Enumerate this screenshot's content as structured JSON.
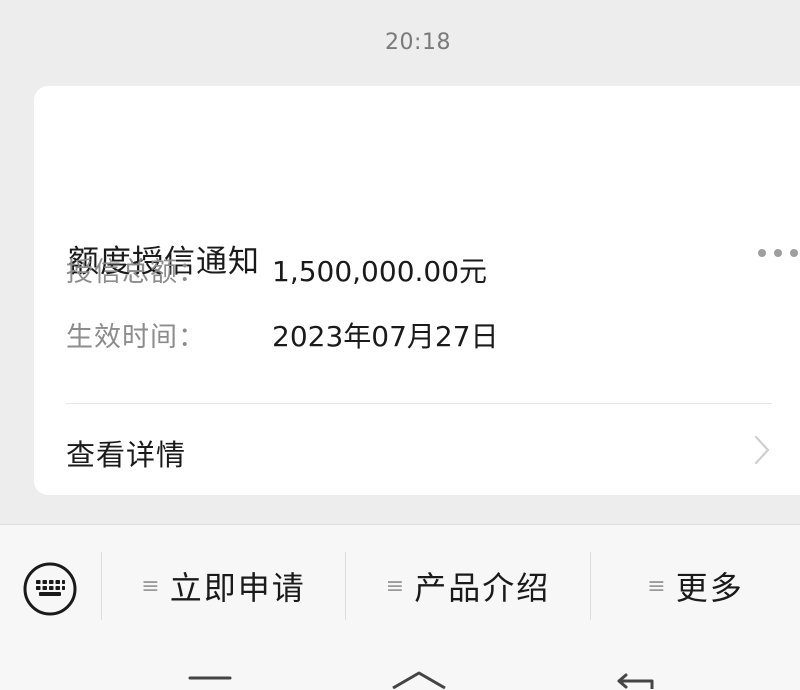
{
  "chat": {
    "timestamp": "20:18"
  },
  "card": {
    "title": "额度授信通知",
    "fields": [
      {
        "label": "授信总额：",
        "value": "1,500,000.00元"
      },
      {
        "label": "生效时间：",
        "value": "2023年07月27日"
      }
    ],
    "detail_label": "查看详情"
  },
  "menu": {
    "items": [
      {
        "label": "立即申请",
        "icon": "menu-lines-icon"
      },
      {
        "label": "产品介绍",
        "icon": "menu-lines-icon"
      },
      {
        "label": "更多",
        "icon": "menu-lines-icon"
      }
    ],
    "keyboard_icon": "keyboard-icon"
  },
  "system_nav": {
    "icons": [
      "menu-icon",
      "home-icon",
      "back-icon"
    ]
  }
}
